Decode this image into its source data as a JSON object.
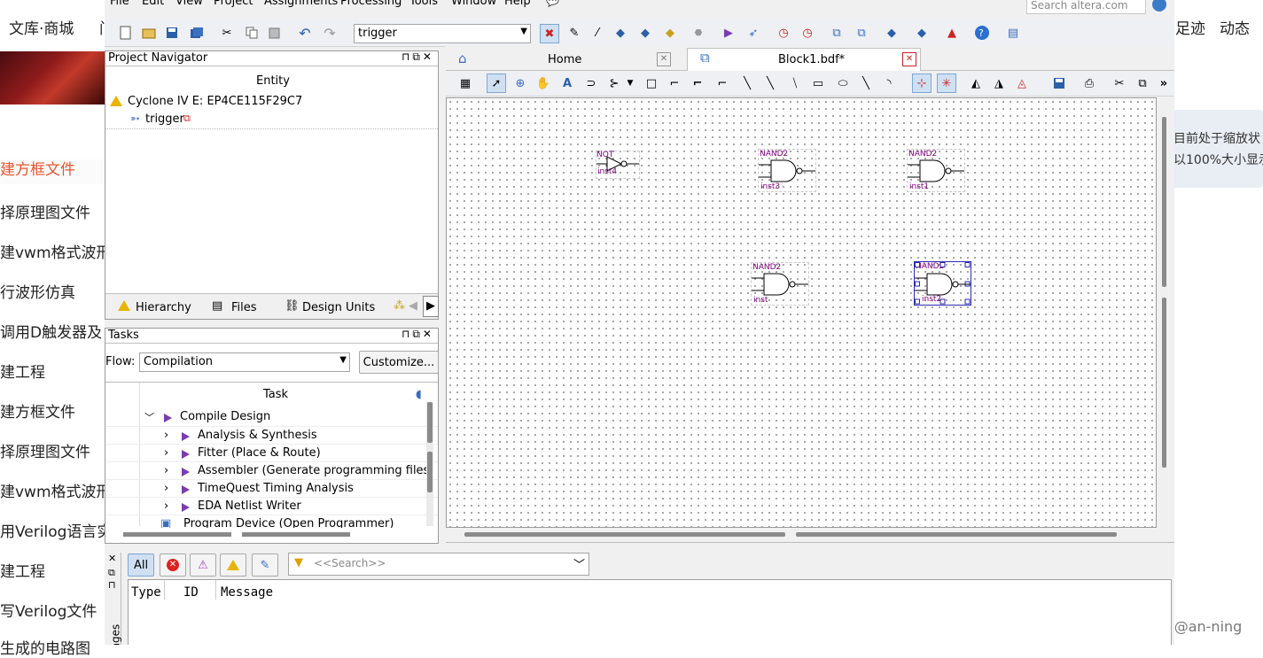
{
  "background_page": {
    "top_nav": [
      "文库·商城",
      "足迹",
      "动态"
    ],
    "sidebar_items": [
      "建方框文件",
      "择原理图文件",
      "建vwm格式波形",
      "行波形仿真",
      "调用D触发器及",
      "建工程",
      "建方框文件",
      "择原理图文件",
      "建vwm格式波形",
      "用Verilog语言实",
      "建工程",
      "写Verilog文件",
      "生成的电路图"
    ],
    "tooltip_lines": [
      "目前处于缩放状",
      "以100%大小显示"
    ],
    "watermark": "CSDN @an-ning"
  },
  "menu": [
    "File",
    "Edit",
    "View",
    "Project",
    "Assignments",
    "Processing",
    "Tools",
    "Window",
    "Help"
  ],
  "search_placeholder": "Search altera.com",
  "toolbar": {
    "entity_selector": "trigger"
  },
  "project_navigator": {
    "title": "Project Navigator",
    "column": "Entity",
    "device": "Cyclone IV E: EP4CE115F29C7",
    "top_entity": "trigger",
    "tabs": [
      "Hierarchy",
      "Files",
      "Design Units"
    ]
  },
  "tasks": {
    "title": "Tasks",
    "flow_label": "Flow:",
    "flow_value": "Compilation",
    "customize_label": "Customize...",
    "column": "Task",
    "items": [
      "Compile Design",
      "Analysis & Synthesis",
      "Fitter (Place & Route)",
      "Assembler (Generate programming files)",
      "TimeQuest Timing Analysis",
      "EDA Netlist Writer",
      "Program Device (Open Programmer)"
    ]
  },
  "doc_tabs": [
    {
      "label": "Home"
    },
    {
      "label": "Block1.bdf*"
    }
  ],
  "schematic": {
    "gates": [
      {
        "type": "NOT",
        "instance": "inst4"
      },
      {
        "type": "NAND2",
        "instance": "inst3"
      },
      {
        "type": "NAND2",
        "instance": "inst1"
      },
      {
        "type": "NAND2",
        "instance": "inst"
      },
      {
        "type": "NAND2",
        "instance": "inst2"
      }
    ]
  },
  "messages": {
    "filter_all": "All",
    "search_placeholder": "<<Search>>",
    "columns": [
      "Type",
      "ID",
      "Message"
    ],
    "side_label": "ages"
  },
  "colors": {
    "accent_red": "#e9542e",
    "gate_label": "#800080",
    "selection_blue": "#2a2ab0"
  }
}
